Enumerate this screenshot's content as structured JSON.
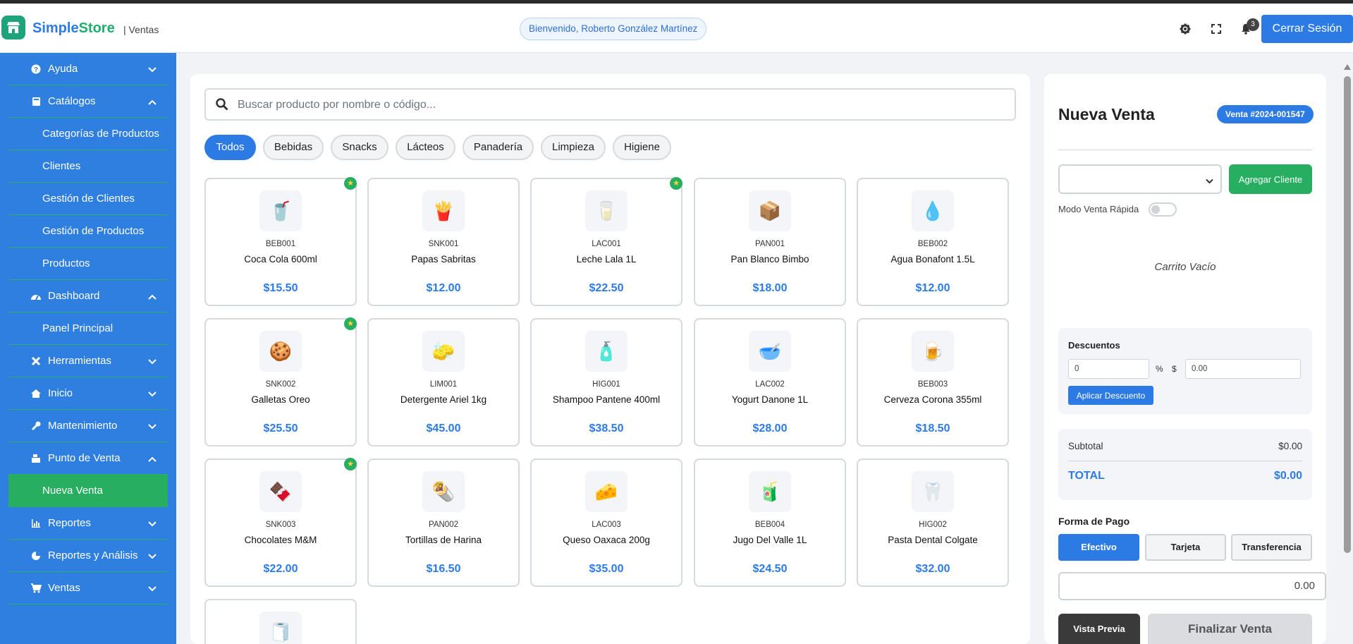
{
  "app": {
    "brand_part1": "Simple",
    "brand_part2": "Store",
    "section": "| Ventas",
    "welcome": "Bienvenido, Roberto González Martínez",
    "notifications_count": "3",
    "logout_label": "Cerrar Sesión",
    "colors": {
      "primary": "#2c7be5",
      "success": "#27ae60",
      "sidebar": "#2f7fe0"
    }
  },
  "sidebar": {
    "items": [
      {
        "label": "Ayuda",
        "icon": "question-circle-icon",
        "expanded": false
      },
      {
        "label": "Catálogos",
        "icon": "book-icon",
        "expanded": true
      },
      {
        "label": "Categorías de Productos"
      },
      {
        "label": "Clientes"
      },
      {
        "label": "Gestión de Clientes"
      },
      {
        "label": "Gestión de Productos"
      },
      {
        "label": "Productos"
      },
      {
        "label": "Dashboard",
        "icon": "gauge-icon",
        "expanded": true
      },
      {
        "label": "Panel Principal"
      },
      {
        "label": "Herramientas",
        "icon": "tools-icon",
        "expanded": false
      },
      {
        "label": "Inicio",
        "icon": "home-icon",
        "expanded": false
      },
      {
        "label": "Mantenimiento",
        "icon": "wrench-icon",
        "expanded": false
      },
      {
        "label": "Punto de Venta",
        "icon": "cash-register-icon",
        "expanded": true
      },
      {
        "label": "Nueva Venta",
        "active": true
      },
      {
        "label": "Reportes",
        "icon": "chart-icon",
        "expanded": false
      },
      {
        "label": "Reportes y Análisis",
        "icon": "pie-chart-icon",
        "expanded": false
      },
      {
        "label": "Ventas",
        "icon": "cart-icon",
        "expanded": false
      }
    ]
  },
  "products": {
    "search_placeholder": "Buscar producto por nombre o código...",
    "categories": [
      "Todos",
      "Bebidas",
      "Snacks",
      "Lácteos",
      "Panadería",
      "Limpieza",
      "Higiene"
    ],
    "active_category": "Todos",
    "items": [
      {
        "code": "BEB001",
        "name": "Coca Cola 600ml",
        "price": "$15.50",
        "emoji": "🥤",
        "featured": true
      },
      {
        "code": "SNK001",
        "name": "Papas Sabritas",
        "price": "$12.00",
        "emoji": "🍟",
        "featured": false
      },
      {
        "code": "LAC001",
        "name": "Leche Lala 1L",
        "price": "$22.50",
        "emoji": "🥛",
        "featured": true
      },
      {
        "code": "PAN001",
        "name": "Pan Blanco Bimbo",
        "price": "$18.00",
        "emoji": "📦",
        "featured": false
      },
      {
        "code": "BEB002",
        "name": "Agua Bonafont 1.5L",
        "price": "$12.00",
        "emoji": "💧",
        "featured": false
      },
      {
        "code": "SNK002",
        "name": "Galletas Oreo",
        "price": "$25.50",
        "emoji": "🍪",
        "featured": true
      },
      {
        "code": "LIM001",
        "name": "Detergente Ariel 1kg",
        "price": "$45.00",
        "emoji": "🧽",
        "featured": false
      },
      {
        "code": "HIG001",
        "name": "Shampoo Pantene 400ml",
        "price": "$38.50",
        "emoji": "🧴",
        "featured": false
      },
      {
        "code": "LAC002",
        "name": "Yogurt Danone 1L",
        "price": "$28.00",
        "emoji": "🥣",
        "featured": false
      },
      {
        "code": "BEB003",
        "name": "Cerveza Corona 355ml",
        "price": "$18.50",
        "emoji": "🍺",
        "featured": false
      },
      {
        "code": "SNK003",
        "name": "Chocolates M&M",
        "price": "$22.00",
        "emoji": "🍫",
        "featured": true
      },
      {
        "code": "PAN002",
        "name": "Tortillas de Harina",
        "price": "$16.50",
        "emoji": "🌯",
        "featured": false
      },
      {
        "code": "LAC003",
        "name": "Queso Oaxaca 200g",
        "price": "$35.00",
        "emoji": "🧀",
        "featured": false
      },
      {
        "code": "BEB004",
        "name": "Jugo Del Valle 1L",
        "price": "$24.50",
        "emoji": "🧃",
        "featured": false
      },
      {
        "code": "HIG002",
        "name": "Pasta Dental Colgate",
        "price": "$32.00",
        "emoji": "🦷",
        "featured": false
      },
      {
        "code": "",
        "name": "",
        "price": "",
        "emoji": "🧻",
        "featured": false
      }
    ]
  },
  "cart": {
    "title": "Nueva Venta",
    "sale_number": "Venta #2024-001547",
    "add_client_label": "Agregar Cliente",
    "quick_mode_label": "Modo Venta Rápida",
    "quick_mode_on": false,
    "empty_label": "Carrito Vacío",
    "discounts": {
      "title": "Descuentos",
      "percent_value": "0",
      "percent_symbol": "%",
      "amount_symbol": "$",
      "amount_value": "0.00",
      "apply_label": "Aplicar Descuento"
    },
    "totals": {
      "subtotal_label": "Subtotal",
      "subtotal_value": "$0.00",
      "total_label": "TOTAL",
      "total_value": "$0.00"
    },
    "payment": {
      "title": "Forma de Pago",
      "methods": [
        "Efectivo",
        "Tarjeta",
        "Transferencia"
      ],
      "active": "Efectivo",
      "amount": "0.00"
    },
    "preview_label": "Vista Previa",
    "finish_label": "Finalizar Venta"
  }
}
